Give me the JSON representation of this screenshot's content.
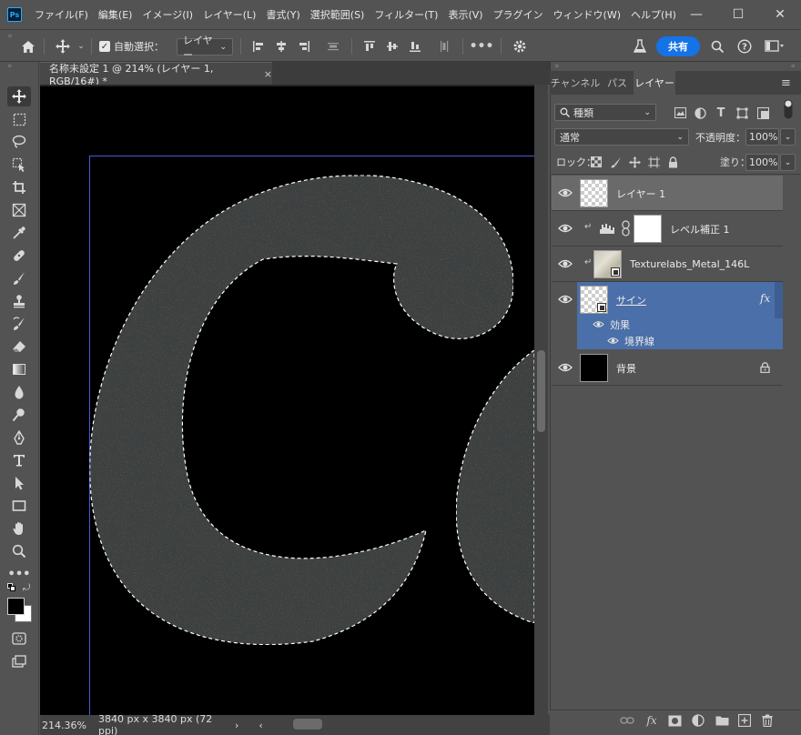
{
  "app": {
    "logo": "Ps",
    "menu": [
      "ファイル(F)",
      "編集(E)",
      "イメージ(I)",
      "レイヤー(L)",
      "書式(Y)",
      "選択範囲(S)",
      "フィルター(T)",
      "表示(V)",
      "プラグイン",
      "ウィンドウ(W)",
      "ヘルプ(H)"
    ],
    "window_controls": {
      "minimize": "—",
      "maximize": "☐",
      "close": "✕"
    }
  },
  "options": {
    "auto_select_label": "自動選択：",
    "auto_select_checked": true,
    "target_value": "レイヤー",
    "share_label": "共有"
  },
  "document": {
    "tab_title": "名称未設定 1 @ 214% (レイヤー 1, RGB/16#) *",
    "close_glyph": "×",
    "zoom": "214.36%",
    "dimensions": "3840 px x 3840 px (72 ppi)",
    "status_arrow": "›"
  },
  "panel": {
    "tabs": [
      "チャンネル",
      "パス",
      "レイヤー"
    ],
    "active_tab": "レイヤー",
    "filter_kind": "種類",
    "blend_mode": "通常",
    "opacity_label": "不透明度：",
    "opacity_value": "100%",
    "lock_label": "ロック：",
    "fill_label": "塗り：",
    "fill_value": "100%",
    "layers": [
      {
        "name": "レイヤー 1",
        "selected": true
      },
      {
        "name": "レベル補正 1"
      },
      {
        "name": "Texturelabs_Metal_146L"
      },
      {
        "name": "サイン",
        "fx": "fx",
        "effects_label": "効果",
        "effect_item": "境界線"
      },
      {
        "name": "背景"
      }
    ]
  },
  "colors": {
    "accent": "#1473e6",
    "layer_active": "#4b6fa8",
    "layer_selected": "#6a6a6a",
    "guide": "#4a5bd6"
  }
}
